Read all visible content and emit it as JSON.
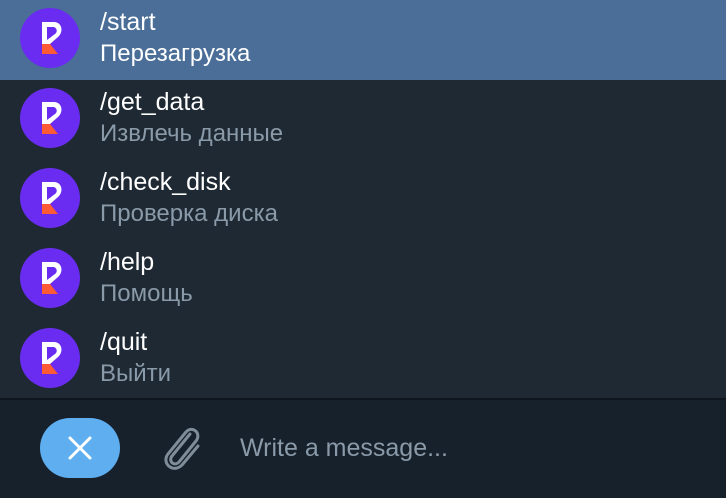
{
  "commands": [
    {
      "name": "/start",
      "description": "Перезагрузка",
      "selected": true
    },
    {
      "name": "/get_data",
      "description": "Извлечь данные",
      "selected": false
    },
    {
      "name": "/check_disk",
      "description": "Проверка диска",
      "selected": false
    },
    {
      "name": "/help",
      "description": "Помощь",
      "selected": false
    },
    {
      "name": "/quit",
      "description": "Выйти",
      "selected": false
    }
  ],
  "bot_avatar": {
    "icon": "bot-logo-icon",
    "background": "#6a2cf0",
    "accent": "#ff5a36"
  },
  "composer": {
    "cancel_icon": "close-icon",
    "attach_icon": "paperclip-icon",
    "message_placeholder": "Write a message...",
    "message_value": ""
  },
  "colors": {
    "selected_row": "#4a6e98",
    "list_background": "#1e2933",
    "cancel_button": "#5eaef0"
  }
}
